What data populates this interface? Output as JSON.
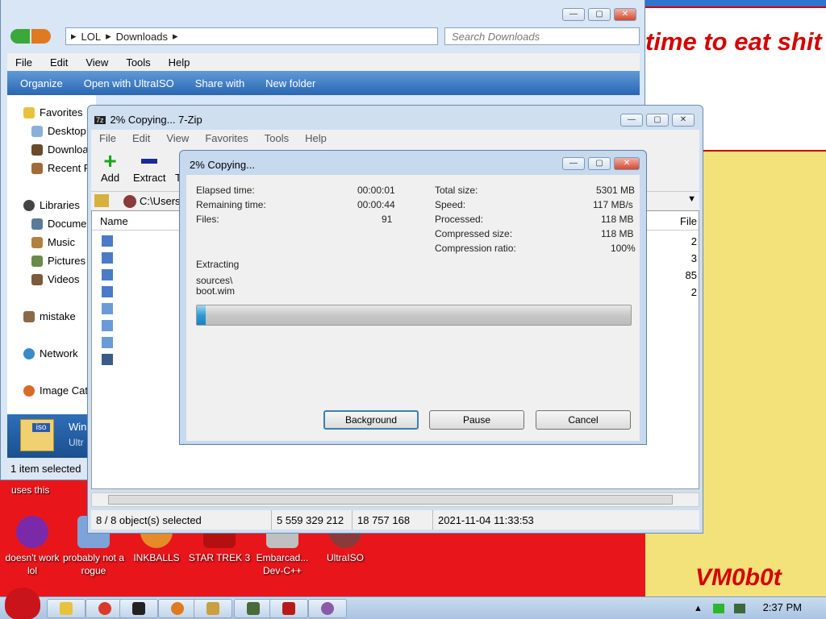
{
  "desktop": {
    "wallpaper_text": "time to eat shit die and chew bubble gum",
    "signature": "VM0b0t",
    "caption": "uses this",
    "icons": [
      {
        "label": "doesn't work lol",
        "color": "#7a2aa8"
      },
      {
        "label": "probably not a rogue",
        "color": "#7da3d8"
      },
      {
        "label": "INKBALLS",
        "color": "#e58b2a"
      },
      {
        "label": "STAR TREK 3",
        "color": "#b31111"
      },
      {
        "label": "Embarcad... Dev-C++",
        "color": "#c0c0c0"
      },
      {
        "label": "UltraISO",
        "color": "#8a3a3a"
      }
    ]
  },
  "explorer": {
    "breadcrumb": [
      "LOL",
      "Downloads"
    ],
    "search_placeholder": "Search Downloads",
    "menu": [
      "File",
      "Edit",
      "View",
      "Tools",
      "Help"
    ],
    "commands": [
      "Organize",
      "Open with UltraISO",
      "Share with",
      "New folder"
    ],
    "nav": [
      "Favorites",
      "Desktop",
      "Downloads",
      "Recent Places",
      "Libraries",
      "Documents",
      "Music",
      "Pictures",
      "Videos",
      "mistake",
      "Network",
      "Image Catalog"
    ],
    "status": "1 item selected",
    "detail_name": "Win",
    "detail_type": "Ultr"
  },
  "zip": {
    "title": "2% Copying... 7-Zip",
    "menu": [
      "File",
      "Edit",
      "View",
      "Favorites",
      "Tools",
      "Help"
    ],
    "tools": [
      "Add",
      "Extract",
      "T"
    ],
    "path": "C:\\Users\\",
    "col_name": "Name",
    "col_right": "File",
    "right_values": [
      "2",
      "3",
      "85",
      "2"
    ],
    "status": [
      "8 / 8 object(s) selected",
      "5 559 329 212",
      "18 757 168",
      "2021-11-04 11:33:53"
    ]
  },
  "dialog": {
    "title": "2% Copying...",
    "elapsed_label": "Elapsed time:",
    "elapsed": "00:00:01",
    "remaining_label": "Remaining time:",
    "remaining": "00:00:44",
    "files_label": "Files:",
    "files": "91",
    "total_label": "Total size:",
    "total": "5301 MB",
    "speed_label": "Speed:",
    "speed": "117 MB/s",
    "processed_label": "Processed:",
    "processed": "118 MB",
    "compressed_label": "Compressed size:",
    "compressed": "118 MB",
    "ratio_label": "Compression ratio:",
    "ratio": "100%",
    "operation": "Extracting",
    "current_dir": "sources\\",
    "current_file": "boot.wim",
    "progress": 0.02,
    "background_btn": "Background",
    "pause_btn": "Pause",
    "cancel_btn": "Cancel"
  },
  "taskbar": {
    "clock": "2:37 PM"
  },
  "colors": {
    "accent": "#2e9bd4",
    "title_red": "#d40000"
  }
}
